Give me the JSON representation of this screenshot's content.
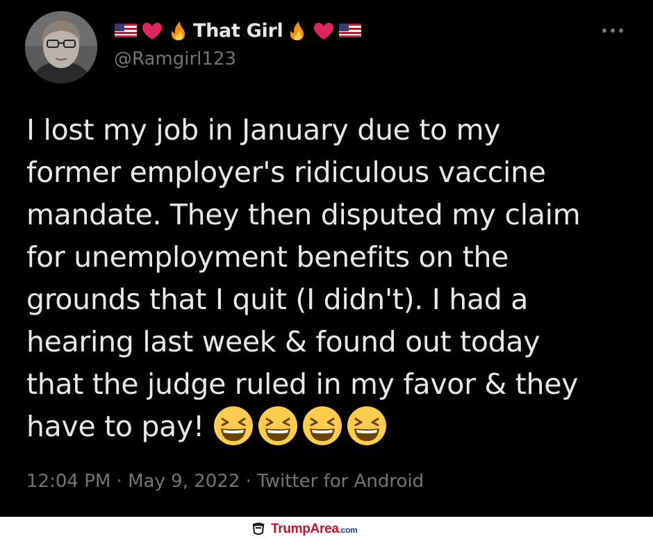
{
  "author": {
    "display_name": "That Girl",
    "handle": "@Ramgirl123",
    "name_emojis": [
      "us-flag-icon",
      "red-heart-icon",
      "fire-icon",
      "fire-icon",
      "red-heart-icon",
      "us-flag-icon"
    ]
  },
  "tweet": {
    "lines": [
      "I lost my job in January due to my",
      "former employer's ridiculous vaccine",
      "mandate. They then disputed my claim",
      "for unemployment benefits on the",
      "grounds that I quit (I didn't). I had a",
      "hearing last week & found out today",
      "that the judge ruled in my favor & they",
      "have to pay!"
    ],
    "trailing_emoji": [
      "laughing-face-icon",
      "laughing-face-icon",
      "laughing-face-icon",
      "laughing-face-icon"
    ]
  },
  "meta": {
    "time": "12:04 PM",
    "separator": "·",
    "date": "May 9, 2022",
    "source": "Twitter for Android"
  },
  "watermark": {
    "brand": "TrumpArea",
    "tld": ".com"
  },
  "colors": {
    "background": "#000000",
    "text_primary": "#e7e9ea",
    "text_secondary": "#71767b",
    "heart": "#e0245e",
    "watermark_red": "#c8102e",
    "watermark_blue": "#1a3a7a"
  }
}
